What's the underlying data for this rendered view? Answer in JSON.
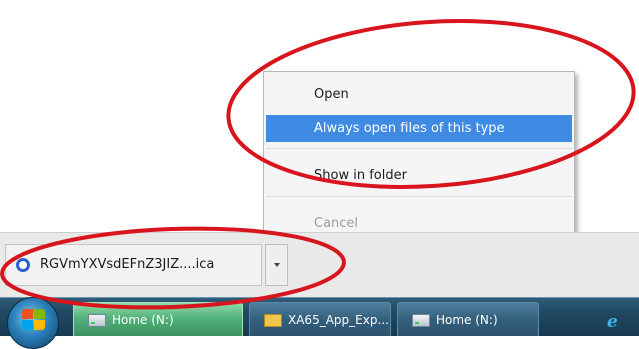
{
  "context_menu": {
    "items": [
      {
        "label": "Open"
      },
      {
        "label": "Always open files of this type"
      },
      {
        "label": "Show in folder"
      },
      {
        "label": "Cancel"
      }
    ]
  },
  "download_bar": {
    "file_name": "RGVmYXVsdEFnZ3JIZ....ica"
  },
  "taskbar": {
    "buttons": [
      {
        "label": "Home (N:)",
        "icon": "drive-icon"
      },
      {
        "label": "XA65_App_Exp...",
        "icon": "folder-icon"
      },
      {
        "label": "Home (N:)",
        "icon": "drive-icon"
      }
    ],
    "quick_icon": "e"
  },
  "colors": {
    "highlight": "#3f8be3",
    "annotation": "#d8141c",
    "taskbar": "#1f4660"
  }
}
